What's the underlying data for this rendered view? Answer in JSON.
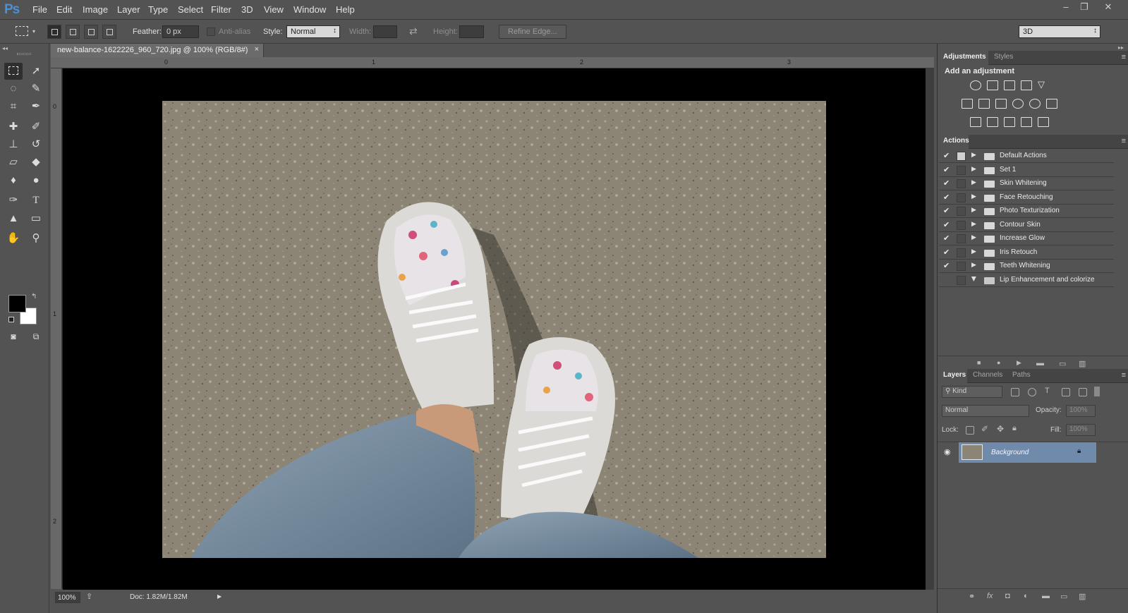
{
  "app": {
    "logo": "Ps"
  },
  "menu": [
    "File",
    "Edit",
    "Image",
    "Layer",
    "Type",
    "Select",
    "Filter",
    "3D",
    "View",
    "Window",
    "Help"
  ],
  "window_controls": {
    "minimize": "–",
    "restore": "❐",
    "close": "✕"
  },
  "options": {
    "feather_label": "Feather:",
    "feather_value": "0 px",
    "antialias_label": "Anti-alias",
    "style_label": "Style:",
    "style_value": "Normal",
    "width_label": "Width:",
    "height_label": "Height:",
    "refine_label": "Refine Edge...",
    "workspace_value": "3D"
  },
  "document": {
    "tab_title": "new-balance-1622226_960_720.jpg @ 100% (RGB/8#)",
    "close": "×",
    "zoom": "100%",
    "doc_info": "Doc: 1.82M/1.82M",
    "ruler_h": [
      "0",
      "1",
      "2",
      "3"
    ],
    "ruler_v": [
      "0",
      "1",
      "2"
    ]
  },
  "colors": {
    "foreground": "#000000",
    "background": "#ffffff",
    "accent": "#6f8aab",
    "app_bg": "#535353"
  },
  "adjustments": {
    "tabs": [
      "Adjustments",
      "Styles"
    ],
    "heading": "Add an adjustment"
  },
  "actions": {
    "tab": "Actions",
    "items": [
      {
        "label": "Default Actions",
        "checked": true
      },
      {
        "label": "Set 1",
        "checked": true
      },
      {
        "label": "Skin Whitening",
        "checked": true
      },
      {
        "label": "Face Retouching",
        "checked": true
      },
      {
        "label": "Photo Texturization",
        "checked": true
      },
      {
        "label": "Contour Skin",
        "checked": true
      },
      {
        "label": "Increase Glow",
        "checked": true
      },
      {
        "label": "Iris Retouch",
        "checked": true
      },
      {
        "label": "Teeth Whitening",
        "checked": true
      },
      {
        "label": "Lip Enhancement and colorize",
        "checked": false
      }
    ]
  },
  "layers": {
    "tabs": [
      "Layers",
      "Channels",
      "Paths"
    ],
    "kind_label": "Kind",
    "blend_mode": "Normal",
    "opacity_label": "Opacity:",
    "opacity_value": "100%",
    "lock_label": "Lock:",
    "fill_label": "Fill:",
    "fill_value": "100%",
    "items": [
      {
        "name": "Background",
        "visible": true,
        "locked": true
      }
    ]
  }
}
